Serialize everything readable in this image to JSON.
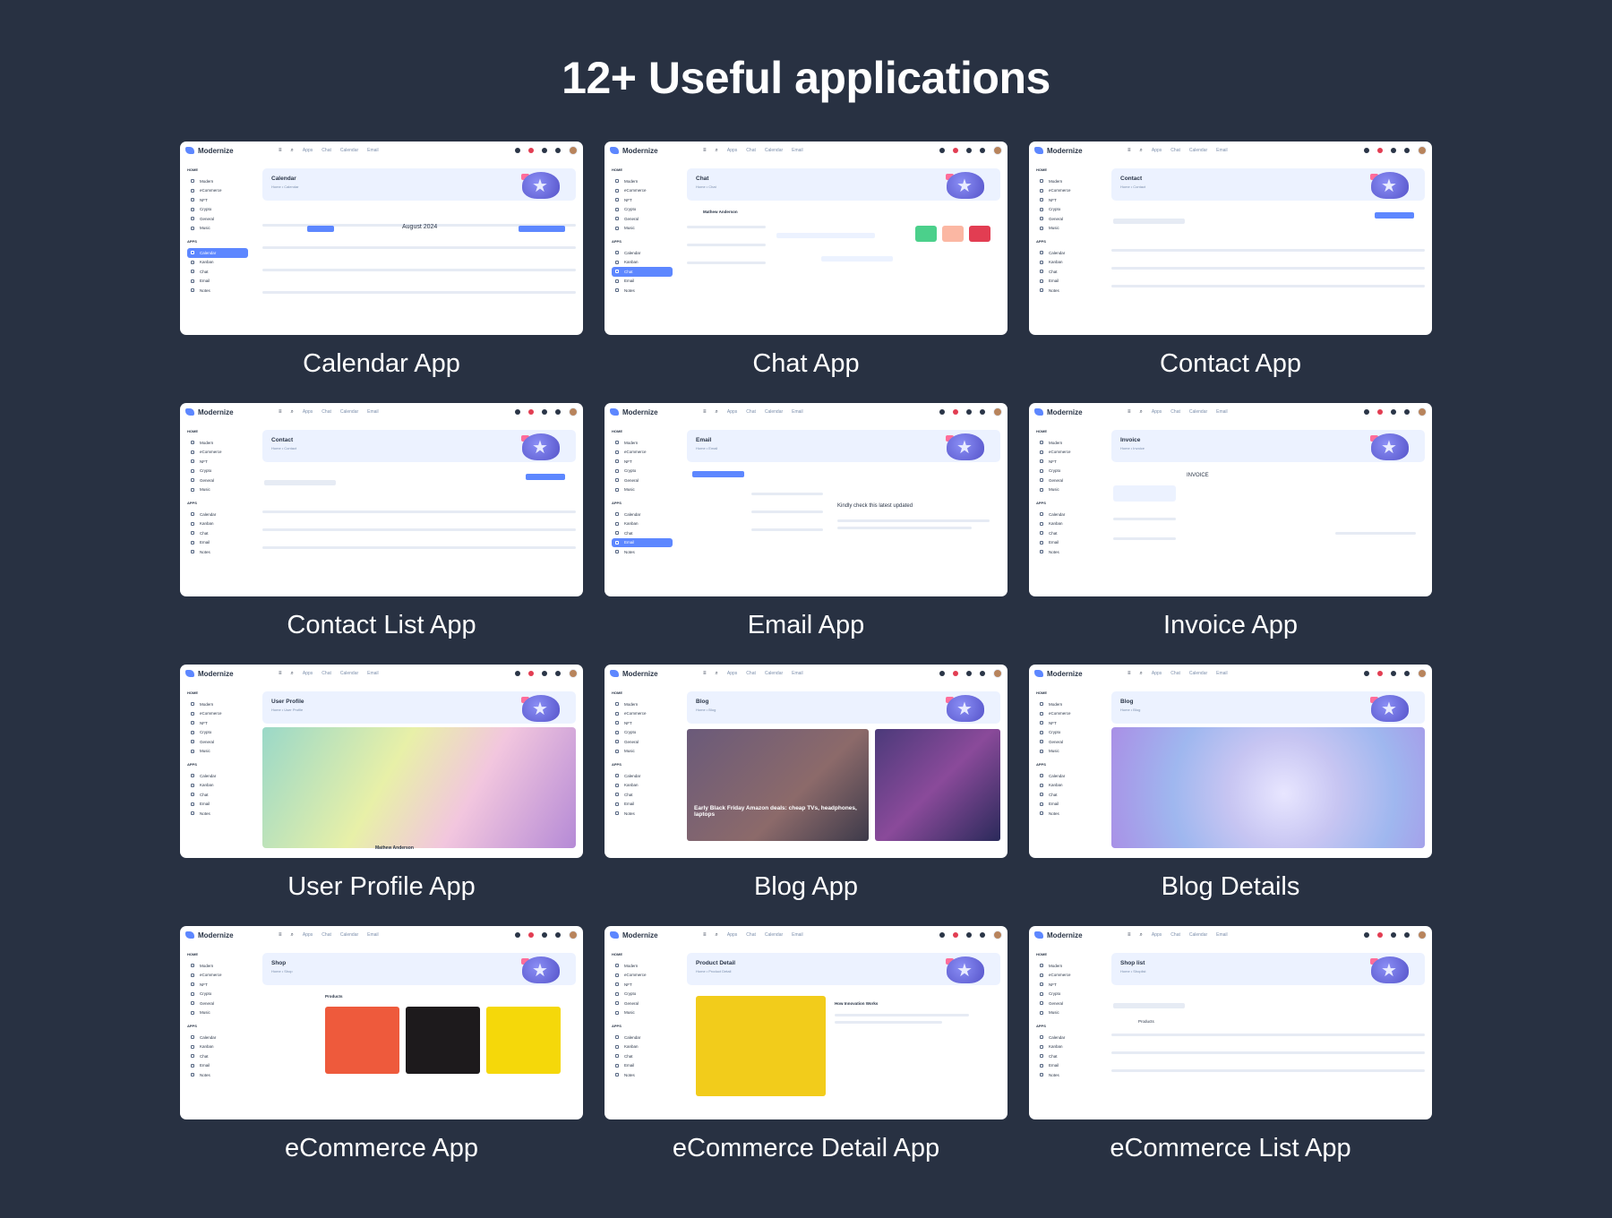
{
  "headline": "12+ Useful applications",
  "colors": {
    "background": "#283142",
    "card": "#ffffff",
    "accent": "#5d87ff",
    "banner": "#ecf2ff"
  },
  "mock": {
    "brand": "Modernize",
    "nav": [
      "Apps",
      "Chat",
      "Calendar",
      "Email"
    ],
    "sidebar_home_heading": "HOME",
    "sidebar_apps_heading": "APPS",
    "sidebar_home": [
      "Modern",
      "eCommerce",
      "NFT",
      "Crypto",
      "General",
      "Music"
    ],
    "sidebar_apps": [
      "Calendar",
      "Kanban",
      "Chat",
      "Email",
      "Notes"
    ]
  },
  "apps": [
    {
      "caption": "Calendar App",
      "page": "Calendar",
      "crumb": "Home • Calendar",
      "active": "Calendar",
      "kind": "calendar",
      "detail": "August 2024"
    },
    {
      "caption": "Chat App",
      "page": "Chat",
      "crumb": "Home • Chat",
      "active": "Chat",
      "kind": "chat",
      "detail": "Mathew Anderson"
    },
    {
      "caption": "Contact App",
      "page": "Contact",
      "crumb": "Home • Contact",
      "active": "",
      "kind": "table",
      "detail": "Add Contact"
    },
    {
      "caption": "Contact List App",
      "page": "Contact",
      "crumb": "Home • Contact",
      "active": "",
      "kind": "table",
      "detail": "Add Contact"
    },
    {
      "caption": "Email App",
      "page": "Email",
      "crumb": "Home • Email",
      "active": "Email",
      "kind": "email",
      "detail": "Kindly check this latest updated"
    },
    {
      "caption": "Invoice App",
      "page": "Invoice",
      "crumb": "Home • Invoice",
      "active": "",
      "kind": "invoice",
      "detail": "INVOICE"
    },
    {
      "caption": "User Profile App",
      "page": "User Profile",
      "crumb": "Home • User Profile",
      "active": "",
      "kind": "profile",
      "detail": "Mathew Anderson"
    },
    {
      "caption": "Blog App",
      "page": "Blog",
      "crumb": "Home • Blog",
      "active": "",
      "kind": "blog",
      "detail": "Early Black Friday Amazon deals: cheap TVs, headphones, laptops"
    },
    {
      "caption": "Blog Details",
      "page": "Blog",
      "crumb": "Home • Blog",
      "active": "",
      "kind": "blogdetail",
      "detail": ""
    },
    {
      "caption": "eCommerce App",
      "page": "Shop",
      "crumb": "Home • Shop",
      "active": "",
      "kind": "shop",
      "detail": "Products"
    },
    {
      "caption": "eCommerce Detail App",
      "page": "Product Detail",
      "crumb": "Home • Product Detail",
      "active": "",
      "kind": "detail",
      "detail": "How Innovation Works"
    },
    {
      "caption": "eCommerce List App",
      "page": "Shop list",
      "crumb": "Home • Shoplist",
      "active": "",
      "kind": "shoplist",
      "detail": "Products"
    }
  ]
}
